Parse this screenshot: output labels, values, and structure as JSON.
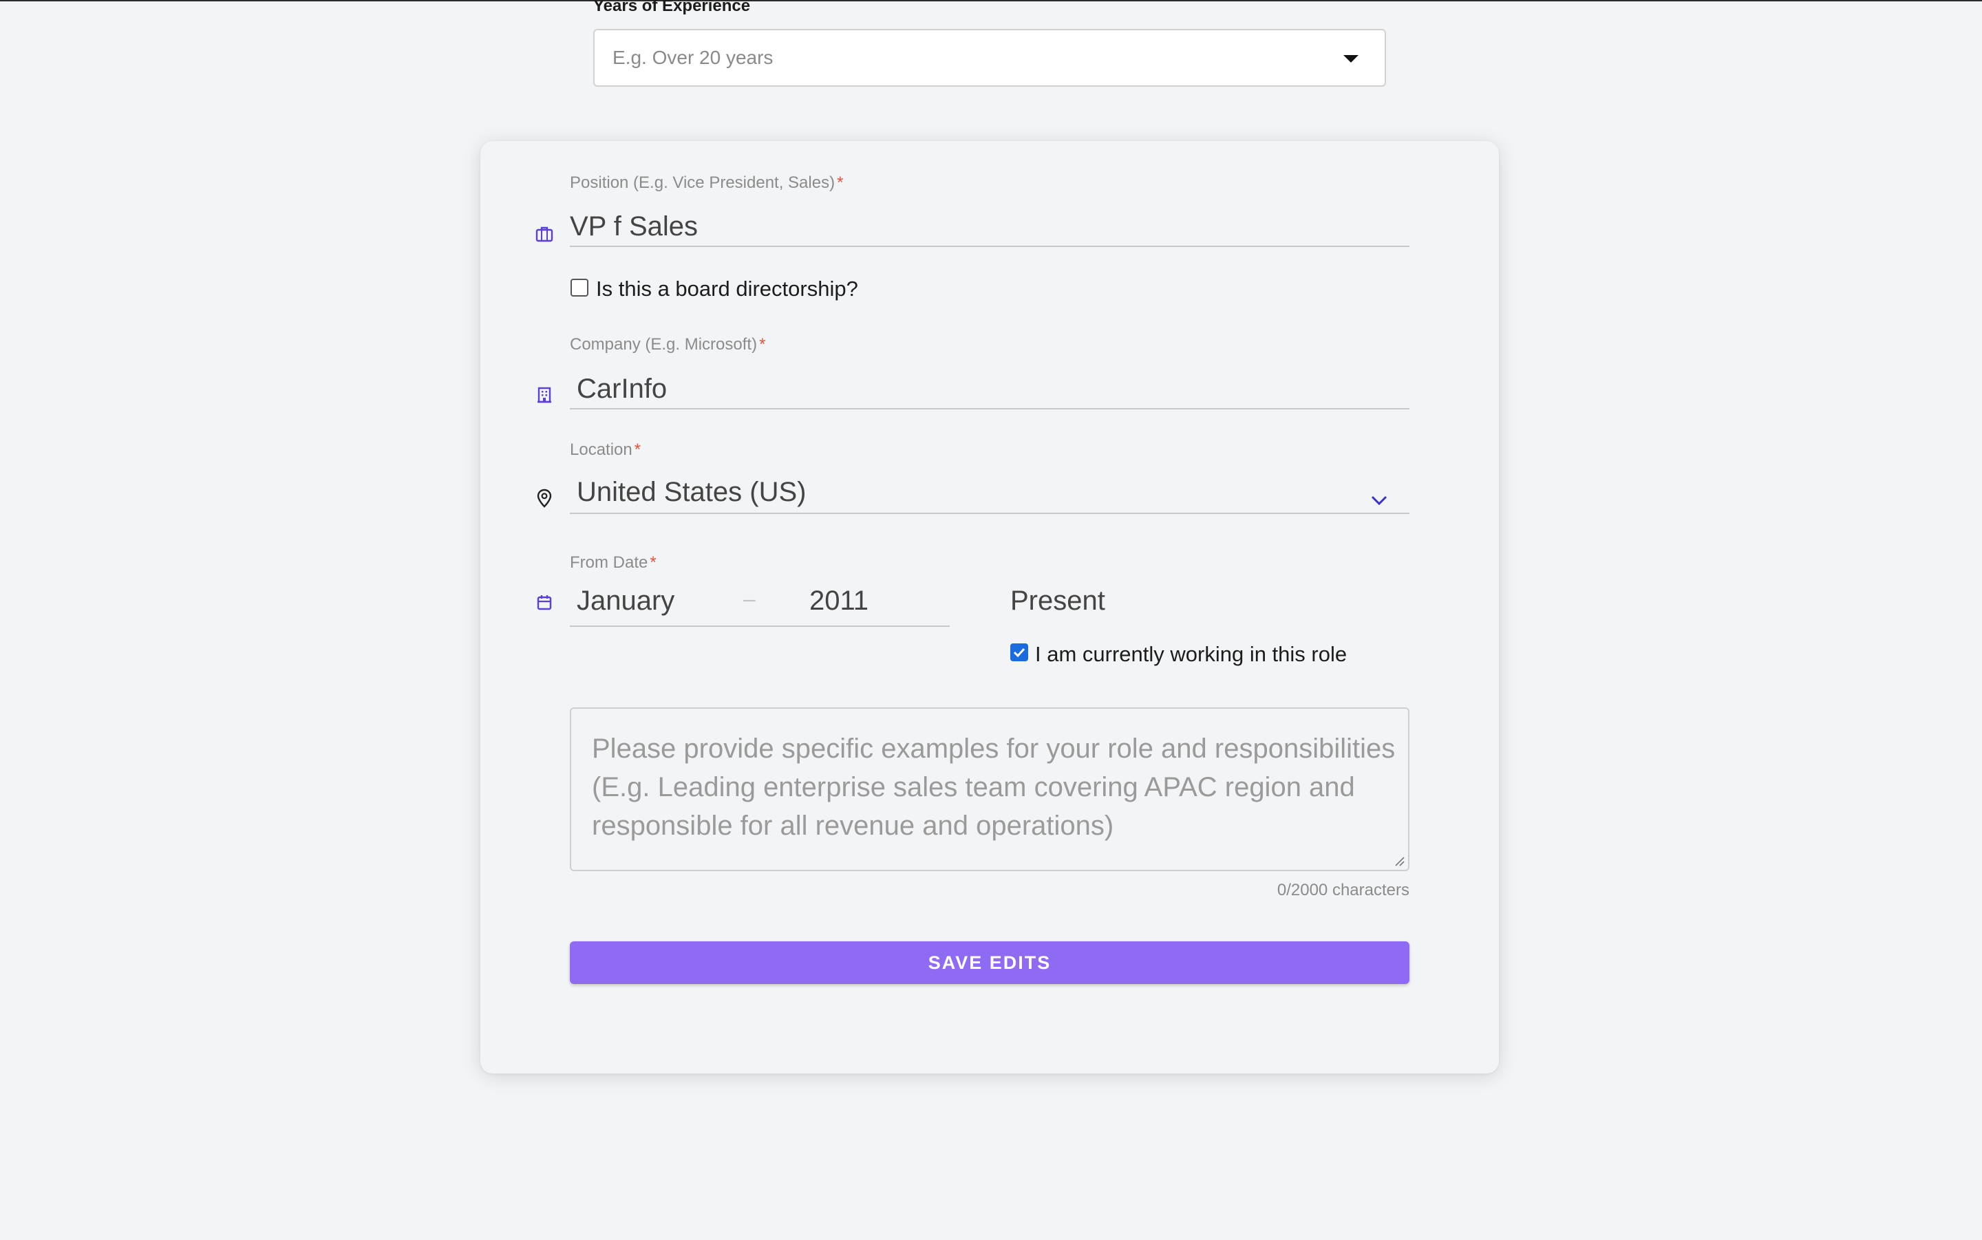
{
  "years_of_experience": {
    "label": "Years of Experience",
    "placeholder": "E.g. Over 20 years"
  },
  "position": {
    "label": "Position (E.g. Vice President, Sales)",
    "required_mark": "*",
    "value": "VP f Sales",
    "icon": "briefcase-icon"
  },
  "board": {
    "label": "Is this a board directorship?",
    "checked": false
  },
  "company": {
    "label": "Company (E.g. Microsoft)",
    "required_mark": "*",
    "value": "CarInfo",
    "icon": "building-icon"
  },
  "location": {
    "label": "Location",
    "required_mark": "*",
    "value": "United States (US)",
    "icon": "map-pin-icon"
  },
  "from_date": {
    "label": "From Date",
    "required_mark": "*",
    "month": "January",
    "separator": "–",
    "year": "2011",
    "to_value": "Present",
    "icon": "calendar-icon"
  },
  "current_role": {
    "label": "I am currently working in this role",
    "checked": true
  },
  "description": {
    "placeholder": "Please provide specific examples for your role and responsibilities (E.g. Leading enterprise sales team covering APAC region and responsible for all revenue and operations)",
    "char_count": "0/2000 characters"
  },
  "save_button": {
    "label": "SAVE EDITS"
  },
  "colors": {
    "accent": "#8f6af3",
    "icon_purple": "#5b3fd8",
    "required": "#e5533d",
    "checkbox_blue": "#1a6be0"
  }
}
